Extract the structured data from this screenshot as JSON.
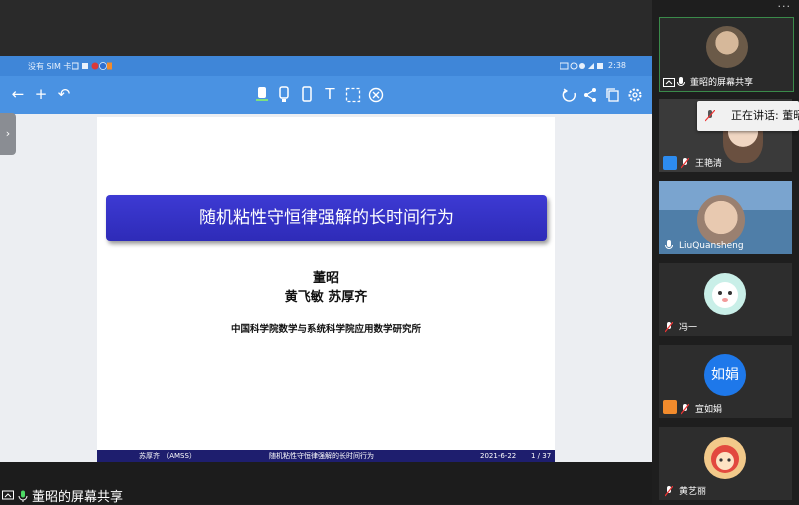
{
  "status_bar": {
    "left_text": "没有 SIM 卡",
    "time": "2:38"
  },
  "slide": {
    "title": "随机粘性守恒律强解的长时间行为",
    "authors_line1": "董昭",
    "authors_line2": "黄飞敏 苏厚齐",
    "institution": "中国科学院数学与系统科学院应用数学研究所",
    "footer": {
      "presenter": "苏厚齐 （AMSS）",
      "title": "随机粘性守恒律强解的长时间行为",
      "date": "2021-6-22",
      "page": "1 / 37"
    }
  },
  "bottom_label": "董昭的屏幕共享",
  "participants": [
    {
      "name": "董昭的屏幕共享",
      "avatar_icon": "person-photo-icon"
    },
    {
      "name": "王艳清",
      "avatar_icon": "person-photo-icon"
    },
    {
      "name": "LiuQuansheng",
      "avatar_icon": "person-photo-icon"
    },
    {
      "name": "冯一",
      "avatar_icon": "cartoon-avatar-icon"
    },
    {
      "name": "宣如娟",
      "avatar_text": "如娟",
      "avatar_color": "#1e78ea"
    },
    {
      "name": "黄艺丽",
      "avatar_icon": "cartoon-avatar-icon"
    }
  ],
  "speaking_tooltip": "正在讲话: 董昭;",
  "colors": {
    "toolbar": "#4a92e2",
    "slide_title_bg": "#3d3ad3",
    "accent_orange": "#f28b2c"
  }
}
